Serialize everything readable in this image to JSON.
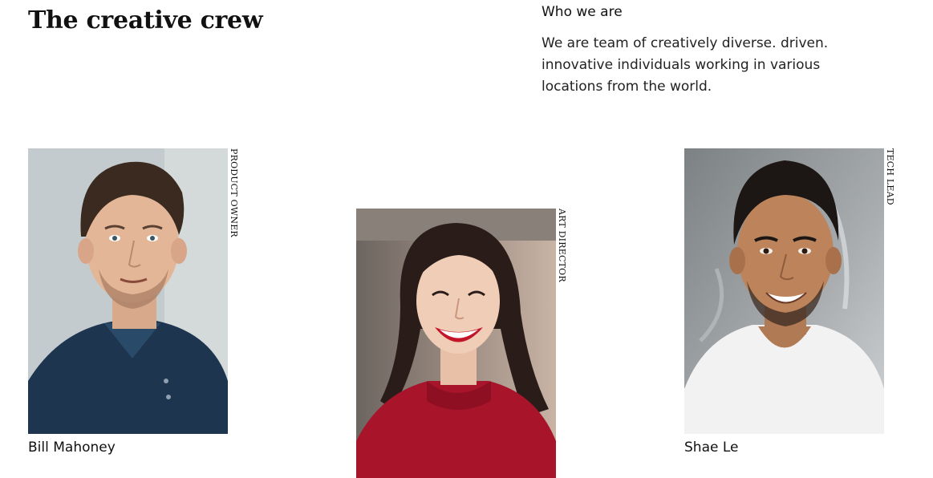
{
  "header": {
    "title": "The creative crew"
  },
  "about": {
    "heading": "Who we are",
    "text": "We are team of creatively diverse. driven. innovative individuals working in various locations from the world."
  },
  "team": [
    {
      "name": "Bill Mahoney",
      "role": "PRODUCT OWNER",
      "photo_icon": "man-portrait-photo"
    },
    {
      "name": "",
      "role": "ART DIRECTOR",
      "photo_icon": "woman-portrait-photo"
    },
    {
      "name": "Shae Le",
      "role": "TECH LEAD",
      "photo_icon": "man-portrait-photo"
    }
  ]
}
